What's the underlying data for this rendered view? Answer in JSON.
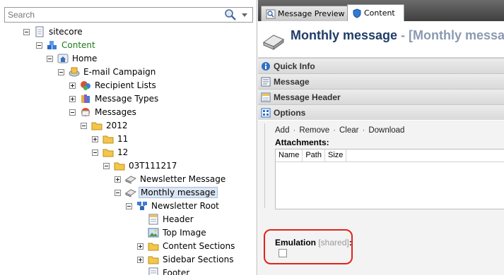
{
  "search": {
    "placeholder": "Search"
  },
  "tree": {
    "sitecore": "sitecore",
    "content": "Content",
    "home": "Home",
    "email_campaign": "E-mail Campaign",
    "recipient_lists": "Recipient Lists",
    "message_types": "Message Types",
    "messages": "Messages",
    "y2012": "2012",
    "m11": "11",
    "m12": "12",
    "folder_03t": "03T111217",
    "newsletter_message": "Newsletter Message",
    "monthly_message": "Monthly message",
    "newsletter_root": "Newsletter Root",
    "header": "Header",
    "top_image": "Top Image",
    "content_sections": "Content Sections",
    "sidebar_sections": "Sidebar Sections",
    "footer": "Footer"
  },
  "tabs": {
    "preview": "Message Preview",
    "content": "Content"
  },
  "editor": {
    "title": "Monthly message",
    "title_suffix": " - [Monthly message",
    "sections": {
      "quick_info": "Quick Info",
      "message": "Message",
      "message_header": "Message Header",
      "options": "Options"
    },
    "attachments": {
      "add": "Add",
      "remove": "Remove",
      "clear": "Clear",
      "download": "Download",
      "bullet": "·",
      "label": "Attachments:",
      "columns": [
        "Name",
        "Path",
        "Size"
      ]
    },
    "emulation": {
      "label": "Emulation",
      "shared": " [shared]",
      "colon": ":"
    }
  },
  "colors": {
    "highlight": "#e2231a",
    "title": "#1f3d66",
    "selection": "#dbe6f4"
  }
}
